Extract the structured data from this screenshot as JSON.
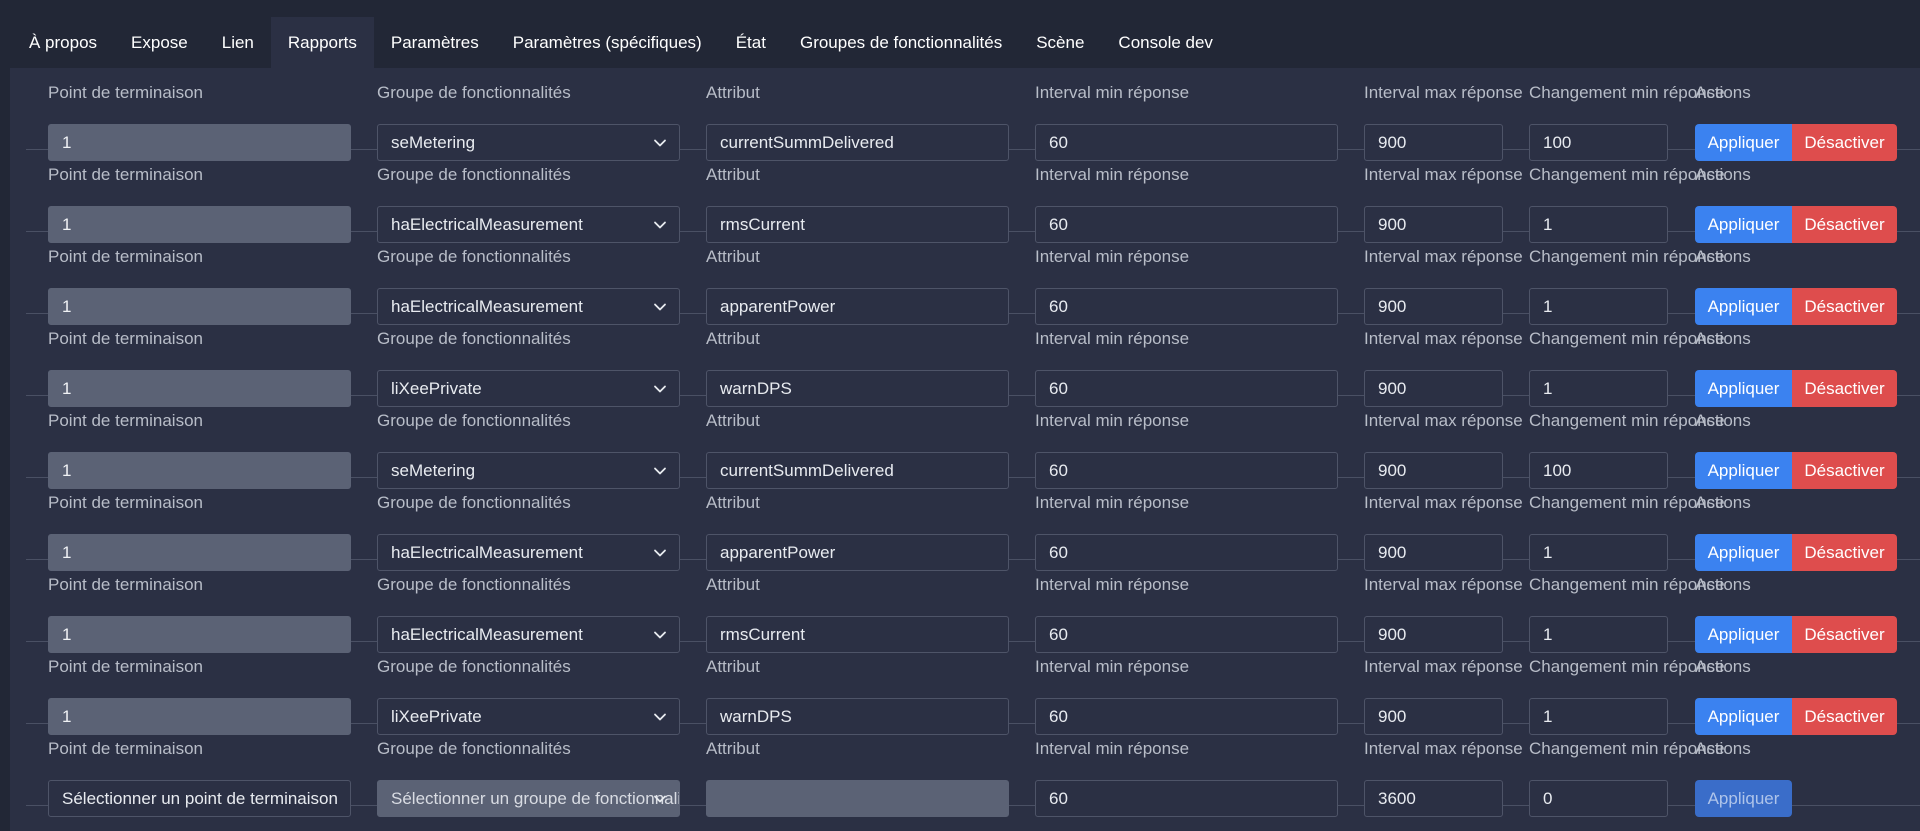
{
  "tabs": [
    {
      "label": "À propos"
    },
    {
      "label": "Expose"
    },
    {
      "label": "Lien"
    },
    {
      "label": "Rapports",
      "active": true
    },
    {
      "label": "Paramètres"
    },
    {
      "label": "Paramètres (spécifiques)"
    },
    {
      "label": "État"
    },
    {
      "label": "Groupes de fonctionnalités"
    },
    {
      "label": "Scène"
    },
    {
      "label": "Console dev"
    }
  ],
  "labels": {
    "endpoint": "Point de terminaison",
    "cluster": "Groupe de fonctionnalités",
    "attribute": "Attribut",
    "min_interval": "Interval min réponse",
    "max_interval": "Interval max réponse",
    "min_change": "Changement min réponse",
    "actions": "Actions"
  },
  "buttons": {
    "apply": "Appliquer",
    "disable": "Désactiver"
  },
  "rows": [
    {
      "endpoint": "1",
      "cluster": "seMetering",
      "attribute": "currentSummDelivered",
      "min": "60",
      "max": "900",
      "change": "100"
    },
    {
      "endpoint": "1",
      "cluster": "haElectricalMeasurement",
      "attribute": "rmsCurrent",
      "min": "60",
      "max": "900",
      "change": "1"
    },
    {
      "endpoint": "1",
      "cluster": "haElectricalMeasurement",
      "attribute": "apparentPower",
      "min": "60",
      "max": "900",
      "change": "1"
    },
    {
      "endpoint": "1",
      "cluster": "liXeePrivate",
      "attribute": "warnDPS",
      "min": "60",
      "max": "900",
      "change": "1"
    },
    {
      "endpoint": "1",
      "cluster": "seMetering",
      "attribute": "currentSummDelivered",
      "min": "60",
      "max": "900",
      "change": "100"
    },
    {
      "endpoint": "1",
      "cluster": "haElectricalMeasurement",
      "attribute": "apparentPower",
      "min": "60",
      "max": "900",
      "change": "1"
    },
    {
      "endpoint": "1",
      "cluster": "haElectricalMeasurement",
      "attribute": "rmsCurrent",
      "min": "60",
      "max": "900",
      "change": "1"
    },
    {
      "endpoint": "1",
      "cluster": "liXeePrivate",
      "attribute": "warnDPS",
      "min": "60",
      "max": "900",
      "change": "1"
    }
  ],
  "new_row": {
    "endpoint_placeholder": "Sélectionner un point de terminaison",
    "cluster_placeholder": "Sélectionner un groupe de fonctionnalités",
    "attribute": "",
    "min": "60",
    "max": "3600",
    "change": "0"
  }
}
